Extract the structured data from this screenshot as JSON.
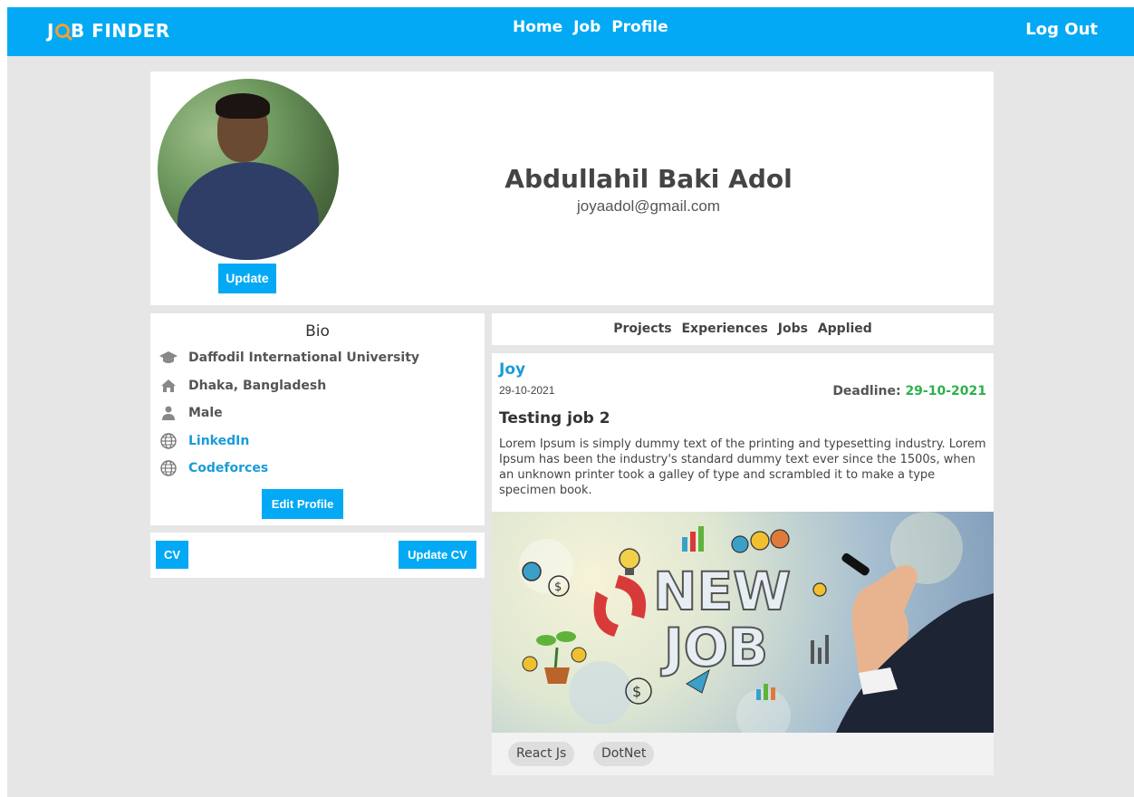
{
  "navbar": {
    "brand_prefix": "J",
    "brand_suffix": "B FINDER",
    "links": [
      "Home",
      "Job",
      "Profile"
    ],
    "logout": "Log Out",
    "color": "#03a9f4"
  },
  "profile": {
    "name": "Abdullahil Baki Adol",
    "email": "joyaadol@gmail.com",
    "update_button": "Update"
  },
  "bio": {
    "title": "Bio",
    "items": [
      {
        "icon": "graduation-cap-icon",
        "text": "Daffodil International University"
      },
      {
        "icon": "home-icon",
        "text": "Dhaka, Bangladesh"
      },
      {
        "icon": "person-icon",
        "text": "Male"
      },
      {
        "icon": "globe-icon",
        "text": "LinkedIn"
      },
      {
        "icon": "globe-icon",
        "text": "Codeforces"
      }
    ],
    "edit_button": "Edit Profile"
  },
  "cv": {
    "cv_button": "CV",
    "update_cv_button": "Update CV"
  },
  "tabs": [
    "Projects",
    "Experiences",
    "Jobs",
    "Applied"
  ],
  "job": {
    "company": "Joy",
    "posted": "29-10-2021",
    "deadline_label": "Deadline:",
    "deadline_date": "29-10-2021",
    "title": "Testing job 2",
    "description": "Lorem Ipsum is simply dummy text of the printing and typesetting industry. Lorem Ipsum has been the industry's standard dummy text ever since the 1500s, when an unknown printer took a galley of type and scrambled it to make a type specimen book.",
    "image_text_line1": "NEW",
    "image_text_line2": "JOB",
    "tags": [
      "React Js",
      "DotNet"
    ]
  }
}
